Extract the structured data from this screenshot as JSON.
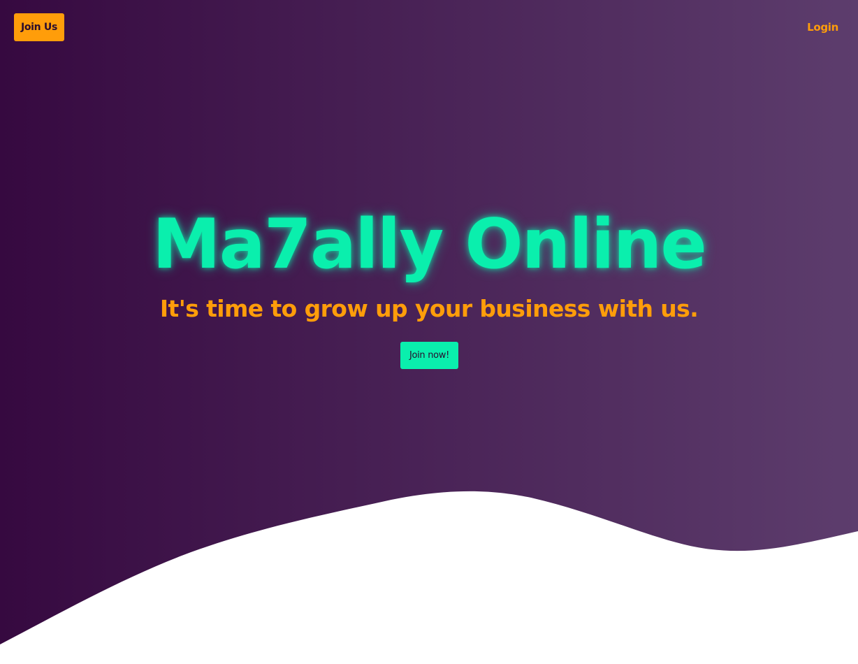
{
  "nav": {
    "join_us_label": "Join Us",
    "login_label": "Login"
  },
  "hero": {
    "title": "Ma7ally Online",
    "subtitle": "It's time to grow up your business with us.",
    "cta_label": "Join now!"
  },
  "colors": {
    "gradient_start": "#360940",
    "gradient_end": "#5d3d6d",
    "accent_orange": "#ff9d0a",
    "accent_green": "#0aefad",
    "wave_fill": "#ffffff"
  }
}
